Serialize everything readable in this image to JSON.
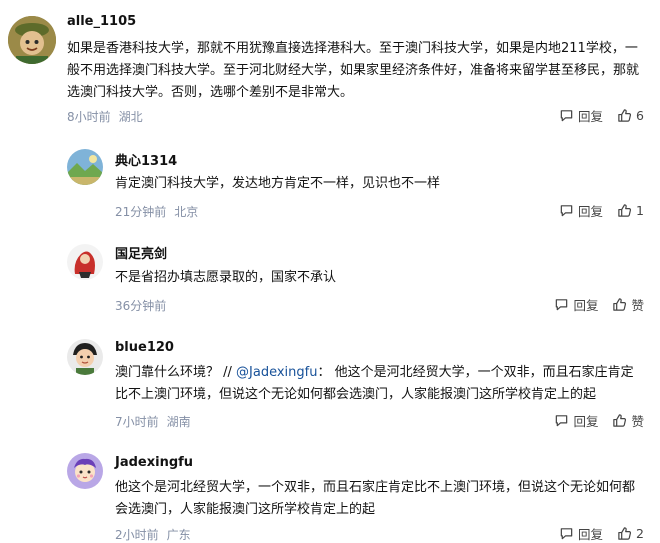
{
  "comments": [
    {
      "username": "alle_1105",
      "content": "如果是香港科技大学，那就不用犹豫直接选择港科大。至于澳门科技大学，如果是内地211学校，一般不用选择澳门科技大学。至于河北财经大学，如果家里经济条件好，准备将来留学甚至移民，那就选澳门科技大学。否则，选哪个差别不是非常大。",
      "time": "8小时前",
      "location": "湖北",
      "reply_label": "回复",
      "like_label": "6",
      "avatar_icon": "green-cartoon-avatar-icon"
    },
    {
      "username": "典心1314",
      "content": "肯定澳门科技大学，发达地方肯定不一样，见识也不一样",
      "time": "21分钟前",
      "location": "北京",
      "reply_label": "回复",
      "like_label": "1",
      "avatar_icon": "landscape-avatar-icon"
    },
    {
      "username": "国足亮剑",
      "content": "不是省招办填志愿录取的，国家不承认",
      "time": "36分钟前",
      "location": "",
      "reply_label": "回复",
      "like_label": "赞",
      "avatar_icon": "red-figure-avatar-icon"
    },
    {
      "username": "blue120",
      "content_prefix": "澳门靠什么环境？ // ",
      "mention": "@Jadexingfu",
      "content_suffix": "： 他这个是河北经贸大学，一个双非，而且石家庄肯定比不上澳门环境，但说这个无论如何都会选澳门，人家能报澳门这所学校肯定上的起",
      "time": "7小时前",
      "location": "湖南",
      "reply_label": "回复",
      "like_label": "赞",
      "avatar_icon": "cartoon-boy-avatar-icon"
    },
    {
      "username": "Jadexingfu",
      "content": "他这个是河北经贸大学，一个双非，而且石家庄肯定比不上澳门环境，但说这个无论如何都会选澳门，人家能报澳门这所学校肯定上的起",
      "time": "2小时前",
      "location": "广东",
      "reply_label": "回复",
      "like_label": "2",
      "avatar_icon": "purple-cartoon-avatar-icon"
    }
  ]
}
